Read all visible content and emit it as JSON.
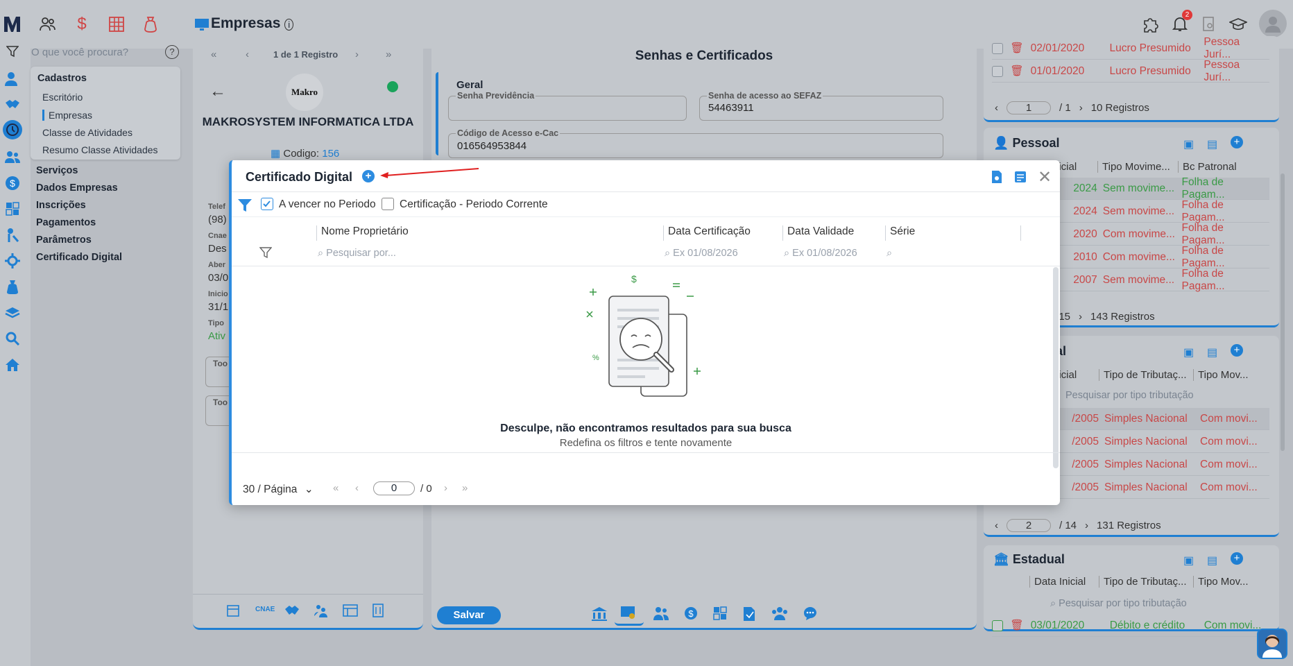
{
  "page": {
    "title": "Empresas"
  },
  "topbar": {
    "notification_count": "2"
  },
  "search": {
    "placeholder": "O que você procura?"
  },
  "menu": {
    "group_title": "Cadastros",
    "group_items": [
      "Escritório",
      "Empresas",
      "Classe de Atividades",
      "Resumo Classe Atividades"
    ],
    "items": [
      "Serviços",
      "Dados Empresas",
      "Inscrições",
      "Pagamentos",
      "Parâmetros",
      "Certificado Digital"
    ]
  },
  "left_panel": {
    "record_nav": "1 de 1 Registro",
    "company_name": "MAKROSYSTEM INFORMATICA LTDA",
    "code_label": "Codigo:",
    "code_value": "156",
    "logo_text": "Makro",
    "partial_labels": [
      "Telef",
      "(98)",
      "Cnae",
      "Des",
      "Aber",
      "03/0",
      "Inicio",
      "31/1",
      "Tipo",
      "Ativ",
      "Too",
      "Too"
    ],
    "bottom_icons": [
      "calendar-icon",
      "cnae-icon",
      "handshake-icon",
      "people-icon",
      "table-icon",
      "building-icon"
    ],
    "cnae_text": "CNAE"
  },
  "mid_panel": {
    "title": "Senhas e Certificados",
    "section": "Geral",
    "fields": [
      {
        "label": "Senha Previdência",
        "value": ""
      },
      {
        "label": "Senha de acesso ao SEFAZ",
        "value": "54463911"
      },
      {
        "label": "Código de Acesso e-Cac",
        "value": "016564953844"
      }
    ],
    "save_label": "Salvar"
  },
  "right_top": {
    "rows": [
      {
        "date": "02/01/2020",
        "regime": "Lucro Presumido",
        "type": "Pessoa Jurí..."
      },
      {
        "date": "01/01/2020",
        "regime": "Lucro Presumido",
        "type": "Pessoa Jurí..."
      }
    ],
    "page_value": "1",
    "page_total": "/ 1",
    "records": "10 Registros"
  },
  "pessoal": {
    "title": "Pessoal",
    "headers": [
      "nicial",
      "Tipo Movime...",
      "Bc Patronal"
    ],
    "rows": [
      {
        "date": "2024",
        "tipo": "Sem movime...",
        "bc": "Folha de Pagam...",
        "color": "green"
      },
      {
        "date": "2024",
        "tipo": "Sem movime...",
        "bc": "Folha de Pagam...",
        "color": "red"
      },
      {
        "date": "2020",
        "tipo": "Com movime...",
        "bc": "Folha de Pagam...",
        "color": "red"
      },
      {
        "date": "2010",
        "tipo": "Com movime...",
        "bc": "Folha de Pagam...",
        "color": "red"
      },
      {
        "date": "2007",
        "tipo": "Sem movime...",
        "bc": "Folha de Pagam...",
        "color": "red"
      }
    ],
    "page_total": "/ 15",
    "records": "143 Registros"
  },
  "federal": {
    "title": "al",
    "headers": [
      "nicial",
      "Tipo de Tributaç...",
      "Tipo Mov..."
    ],
    "search_placeholder": "Pesquisar por tipo tributação",
    "rows": [
      {
        "date": "/2005",
        "tipo": "Simples Nacional",
        "mov": "Com movi..."
      },
      {
        "date": "/2005",
        "tipo": "Simples Nacional",
        "mov": "Com movi..."
      },
      {
        "date": "/2005",
        "tipo": "Simples Nacional",
        "mov": "Com movi..."
      },
      {
        "date": "/2005",
        "tipo": "Simples Nacional",
        "mov": "Com movi..."
      }
    ],
    "page_value": "2",
    "page_total": "/ 14",
    "records": "131 Registros"
  },
  "estadual": {
    "title": "Estadual",
    "headers": [
      "Data Inicial",
      "Tipo de Tributaç...",
      "Tipo Mov..."
    ],
    "search_placeholder": "Pesquisar por tipo tributação",
    "row": {
      "date": "03/01/2020",
      "tipo": "Débito e crédito",
      "mov": "Com movi..."
    }
  },
  "modal": {
    "title": "Certificado Digital",
    "filter_a": "A vencer no Periodo",
    "filter_b": "Certificação - Periodo Corrente",
    "columns": [
      "Nome Proprietário",
      "Data Certificação",
      "Data Validade",
      "Série"
    ],
    "search_placeholder": "Pesquisar por...",
    "date_placeholder": "Ex 01/08/2026",
    "empty_title": "Desculpe, não encontramos resultados para sua busca",
    "empty_subtitle": "Redefina os filtros e tente novamente",
    "page_size": "30 / Página",
    "page_value": "0",
    "page_total": "/ 0"
  },
  "colors": {
    "accent": "#1f7fd2",
    "red": "#c84747",
    "green": "#3a9a46",
    "online": "#1aa35b"
  }
}
